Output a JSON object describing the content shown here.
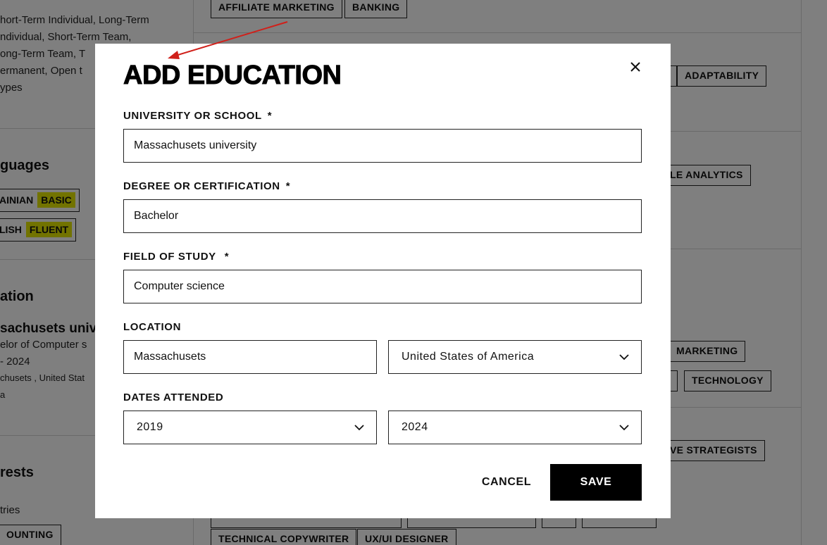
{
  "background": {
    "left_text_lines": [
      "hort-Term Individual, Long-Term",
      "ndividual, Short-Term Team,",
      "ong-Term Team, T",
      "ermanent, Open t",
      "ypes"
    ],
    "languages_heading": "guages",
    "languages": [
      {
        "name": "AINIAN",
        "level": "BASIC"
      },
      {
        "name": "LISH",
        "level": "FLUENT"
      }
    ],
    "education_heading": "ation",
    "education_school": "sachusets univ",
    "education_degree": "elor of Computer s",
    "education_years": "- 2024",
    "education_location": "chusets , United Stat",
    "education_location_2": "a",
    "interests_heading": "rests",
    "interests_sub": "tries",
    "interests_tag": "OUNTING",
    "tags": {
      "affiliate": "AFFILIATE MARKETING",
      "banking": "BANKING",
      "adaptability": "ADAPTABILITY",
      "analytics": "LE ANALYTICS",
      "marketing": "MARKETING",
      "technology": "TECHNOLOGY",
      "strategists": "VE STRATEGISTS",
      "copywriter": "TECHNICAL COPYWRITER",
      "uxui": "UX/UI DESIGNER"
    }
  },
  "modal": {
    "title": "ADD EDUCATION",
    "close_icon": "close-icon",
    "school": {
      "label": "UNIVERSITY OR SCHOOL",
      "required": "*",
      "value": "Massachusets university"
    },
    "degree": {
      "label": "DEGREE OR CERTIFICATION",
      "required": "*",
      "value": "Bachelor"
    },
    "field": {
      "label": "FIELD OF STUDY",
      "required": "*",
      "value": "Computer science"
    },
    "location": {
      "label": "LOCATION",
      "city_value": "Massachusets",
      "country_value": "United States of America"
    },
    "dates": {
      "label": "DATES ATTENDED",
      "start_value": "2019",
      "end_value": "2024"
    },
    "cancel_label": "CANCEL",
    "save_label": "SAVE"
  },
  "colors": {
    "overlay": "rgba(0,0,0,0.5)",
    "level_highlight": "#e5e600",
    "save_bg": "#000000",
    "annotation_arrow": "#d0201a"
  }
}
